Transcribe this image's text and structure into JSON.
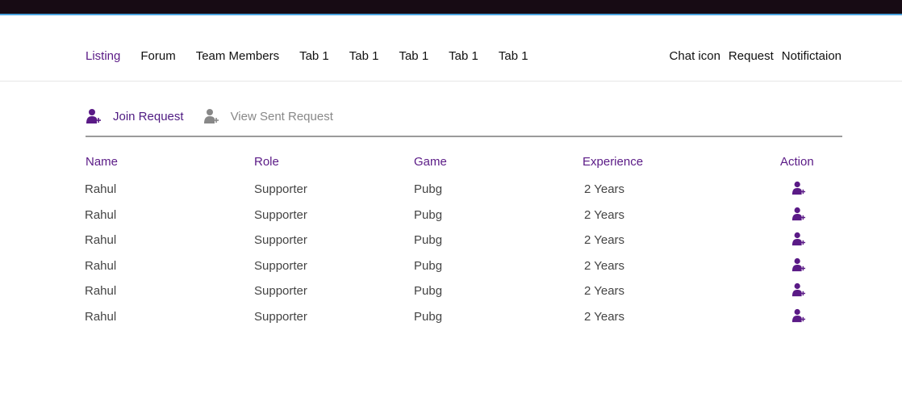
{
  "nav": {
    "left_items": [
      {
        "label": "Listing",
        "active": true
      },
      {
        "label": "Forum",
        "active": false
      },
      {
        "label": "Team Members",
        "active": false
      },
      {
        "label": "Tab 1",
        "active": false
      },
      {
        "label": "Tab 1",
        "active": false
      },
      {
        "label": "Tab 1",
        "active": false
      },
      {
        "label": "Tab 1",
        "active": false
      },
      {
        "label": "Tab 1",
        "active": false
      }
    ],
    "right_items": {
      "chat": "Chat icon",
      "request": "Request",
      "notification": "Notifictaion"
    }
  },
  "subtabs": {
    "join_request": "Join Request",
    "view_sent_request": "View Sent Request"
  },
  "table": {
    "headers": {
      "name": "Name",
      "role": "Role",
      "game": "Game",
      "experience": "Experience",
      "action": "Action"
    },
    "rows": [
      {
        "name": "Rahul",
        "role": "Supporter",
        "game": "Pubg",
        "experience": "2 Years"
      },
      {
        "name": "Rahul",
        "role": "Supporter",
        "game": "Pubg",
        "experience": "2 Years"
      },
      {
        "name": "Rahul",
        "role": "Supporter",
        "game": "Pubg",
        "experience": "2 Years"
      },
      {
        "name": "Rahul",
        "role": "Supporter",
        "game": "Pubg",
        "experience": "2 Years"
      },
      {
        "name": "Rahul",
        "role": "Supporter",
        "game": "Pubg",
        "experience": "2 Years"
      },
      {
        "name": "Rahul",
        "role": "Supporter",
        "game": "Pubg",
        "experience": "2 Years"
      }
    ],
    "action_icon": "add-user-icon"
  },
  "colors": {
    "topbar": "#170b14",
    "topbar_accent": "#4aa3df",
    "accent": "#5a1a86",
    "icon_inactive": "#888888"
  }
}
